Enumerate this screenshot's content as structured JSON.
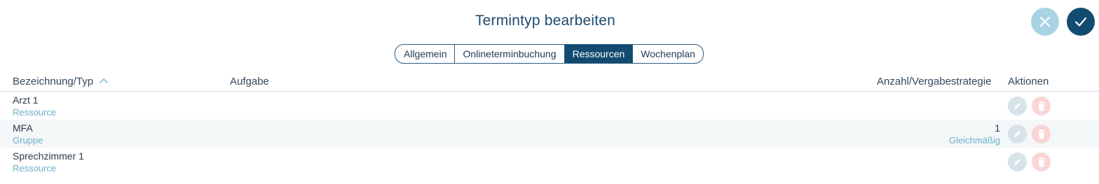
{
  "header": {
    "title": "Termintyp bearbeiten"
  },
  "tabs": [
    {
      "label": "Allgemein",
      "active": false
    },
    {
      "label": "Onlineterminbuchung",
      "active": false
    },
    {
      "label": "Ressourcen",
      "active": true
    },
    {
      "label": "Wochenplan",
      "active": false
    }
  ],
  "table": {
    "columns": {
      "name": "Bezeichnung/Typ",
      "task": "Aufgabe",
      "count": "Anzahl/Vergabestrategie",
      "actions": "Aktionen"
    },
    "sort": {
      "column": "name",
      "direction": "ascending",
      "icon": "chevron-up-icon"
    },
    "rows": [
      {
        "name": "Arzt 1",
        "type": "Ressource",
        "task": "",
        "count": "",
        "strategy": ""
      },
      {
        "name": "MFA",
        "type": "Gruppe",
        "task": "",
        "count": "1",
        "strategy": "Gleichmäßig"
      },
      {
        "name": "Sprechzimmer 1",
        "type": "Ressource",
        "task": "",
        "count": "",
        "strategy": ""
      }
    ]
  },
  "icons": {
    "cancel": "close-icon",
    "confirm": "check-icon",
    "edit": "pencil-icon",
    "delete": "trash-icon"
  },
  "colors": {
    "primary": "#124b70",
    "cancel_button": "#a8d3e3",
    "subtext": "#6ab0c8",
    "edit_button": "#d7e3e8",
    "delete_button": "#fbd5d6",
    "row_alt": "#f4f7f8"
  }
}
